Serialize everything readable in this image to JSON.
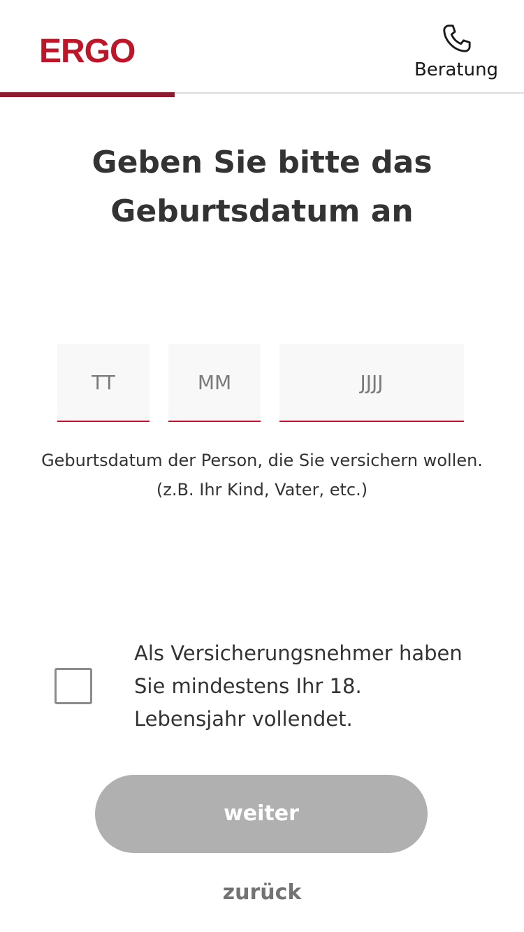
{
  "header": {
    "logo_text": "ERGO",
    "contact_label": "Beratung",
    "contact_icon": "phone-icon",
    "brand_color": "#bf1528",
    "progress_fraction": 0.333
  },
  "main": {
    "title": "Geben Sie bitte das Geburtsdatum an",
    "date": {
      "day_placeholder": "TT",
      "month_placeholder": "MM",
      "year_placeholder": "JJJJ",
      "day_value": "",
      "month_value": "",
      "year_value": ""
    },
    "hint": "Geburtsdatum der Person, die Sie versichern wollen. (z.B. Ihr Kind, Vater, etc.)",
    "consent": {
      "checked": false,
      "label": "Als Versicherungsnehmer haben Sie mindestens Ihr 18. Lebensjahr vollendet."
    }
  },
  "actions": {
    "next_label": "weiter",
    "back_label": "zurück"
  }
}
